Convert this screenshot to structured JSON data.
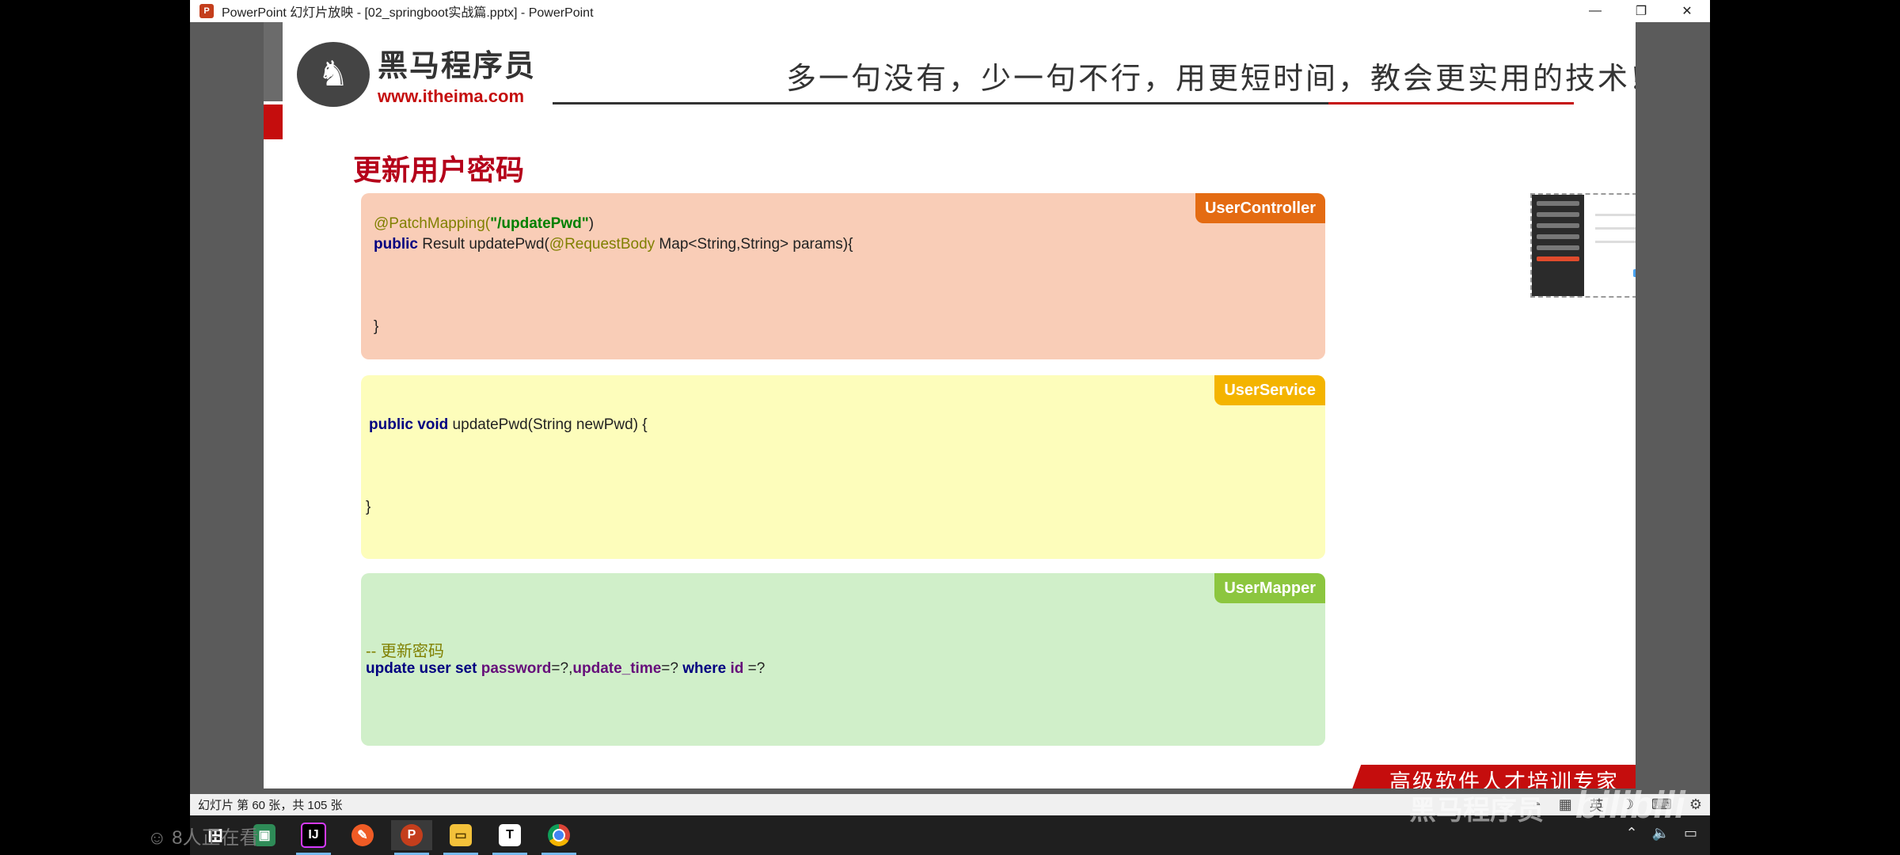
{
  "window": {
    "title": "PowerPoint 幻灯片放映 - [02_springboot实战篇.pptx] - PowerPoint",
    "minimize": "—",
    "restore": "❐",
    "close": "✕"
  },
  "slide": {
    "logo_cn": "黑马程序员",
    "logo_url": "www.itheima.com",
    "slogan": "多一句没有，少一句不行，用更短时间，教会更实用的技术!",
    "title": "更新用户密码",
    "controller": {
      "tag": "UserController",
      "line1_annotation": "@PatchMapping(",
      "line1_string": "\"/updatePwd\"",
      "line1_close": ")",
      "line2_kw": "public",
      "line2_text1": " Result updatePwd(",
      "line2_annotation": "@RequestBody",
      "line2_text2": " Map<String,String> params){",
      "closing": "}"
    },
    "service": {
      "tag": "UserService",
      "kw": "public void",
      "text": " updatePwd(String newPwd) {",
      "closing": "}"
    },
    "mapper": {
      "tag": "UserMapper",
      "comment": "-- 更新密码",
      "sql": {
        "k1": "update user set",
        "f1": "password",
        "t1": "=?,",
        "f2": "update_time",
        "t2": "=?",
        "k2": "where",
        "f3": "id",
        "t3": " =?"
      }
    },
    "banner": "高级软件人才培训专家"
  },
  "statusbar": {
    "slide_info": "幻灯片 第 60 张，共 105 张",
    "lang": "英"
  },
  "taskbar": {
    "viewers": "8人正在看",
    "apps": [
      "start",
      "explorer-app",
      "intellij",
      "postman",
      "powerpoint",
      "file-explorer",
      "typora",
      "chrome"
    ]
  },
  "watermark": {
    "left": "黑马程序员",
    "right": "bilibili"
  }
}
